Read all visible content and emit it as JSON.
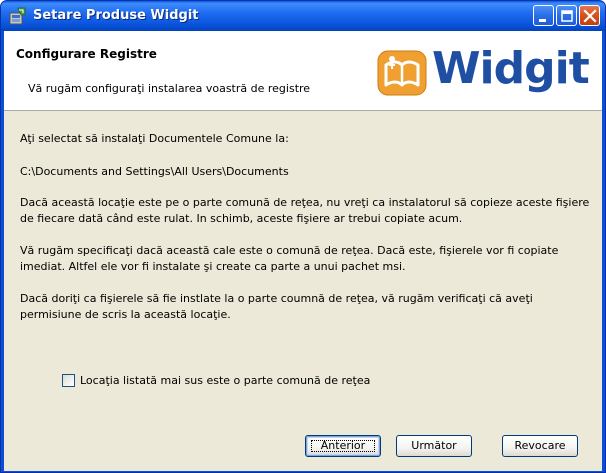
{
  "window": {
    "title": "Setare Produse Widgit",
    "controls": [
      "minimize-icon",
      "maximize-icon",
      "close-icon"
    ]
  },
  "banner": {
    "title": "Configurare Registre",
    "subtitle": "Vă rugăm configuraţi instalarea voastră de registre",
    "logo_text": "Widgit",
    "logo_color": "#1f4fa3"
  },
  "content": {
    "intro": "Aţi selectat să instalaţi Documentele Comune la:",
    "path": "C:\\Documents and Settings\\All Users\\Documents",
    "para1": "Dacă această locaţie este pe o parte comună de reţea, nu vreţi ca instalatorul să copieze aceste fişiere de fiecare dată când este rulat. In schimb, aceste fişiere ar trebui copiate acum.",
    "para2": "Vă rugăm specificaţi dacă această cale este o comună de reţea. Dacă este, fişierele vor fi copiate imediat. Altfel ele vor fi instalate şi create ca parte a unui pachet msi.",
    "para3": "Dacă doriţi ca fişierele să fie instlate la o parte coumnă de reţea, vă rugăm verificaţi că aveţi permisiune de scris la această locaţie."
  },
  "checkbox": {
    "label": "Locaţia listată mai sus este o parte comună de reţea",
    "checked": false
  },
  "buttons": {
    "back": "Anterior",
    "next": "Următor",
    "cancel": "Revocare"
  }
}
